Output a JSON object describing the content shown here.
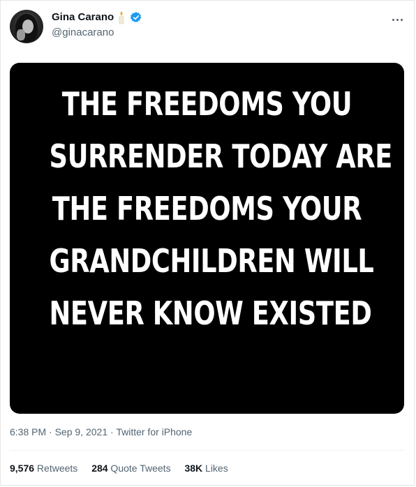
{
  "author": {
    "name": "Gina Carano",
    "handle": "@ginacarano",
    "avatar_icon": "profile-photo",
    "badge_icons": [
      "candle-emoji-icon",
      "verified-badge-icon"
    ],
    "verified_color": "#1d9bf0"
  },
  "menu_icon": "more-dots-icon",
  "media": {
    "background": "#000000",
    "text_color": "#ffffff",
    "lines": [
      "THE FREEDOMS YOU",
      "SURRENDER TODAY ARE",
      "THE FREEDOMS YOUR",
      "GRANDCHILDREN WILL",
      "NEVER KNOW EXISTED"
    ]
  },
  "meta": {
    "time": "6:38 PM",
    "sep1": " · ",
    "date": "Sep 9, 2021",
    "sep2": " · ",
    "source": "Twitter for iPhone"
  },
  "stats": {
    "retweets_count": "9,576",
    "retweets_label": " Retweets",
    "quotes_count": "284",
    "quotes_label": " Quote Tweets",
    "likes_count": "38K",
    "likes_label": " Likes"
  }
}
